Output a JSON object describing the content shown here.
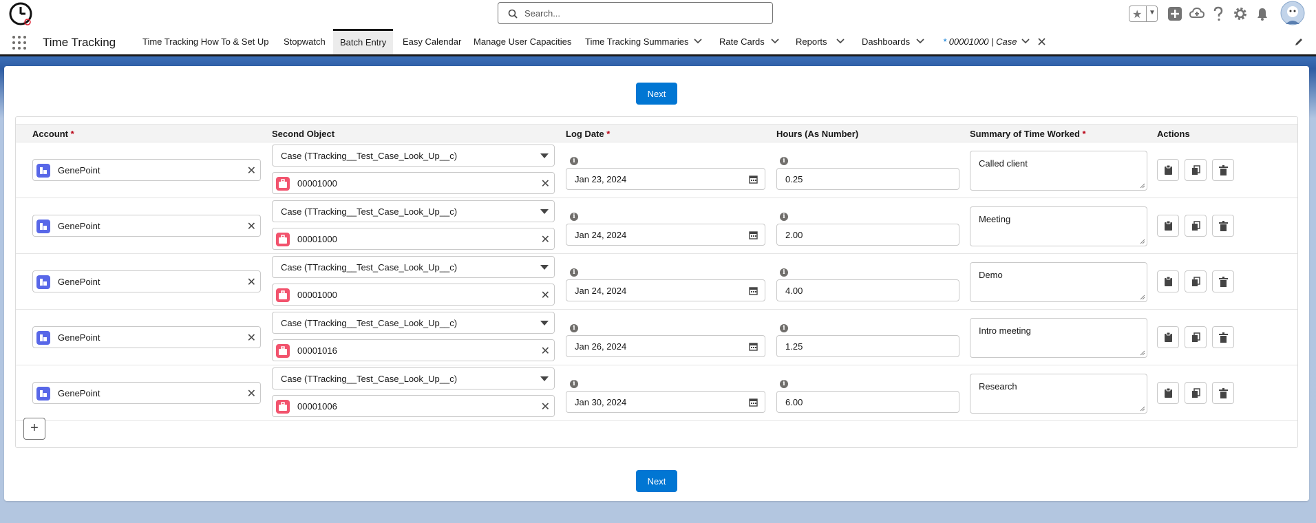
{
  "header": {
    "search_placeholder": "Search..."
  },
  "nav": {
    "app_name": "Time Tracking",
    "items": [
      {
        "label": "Time Tracking How To & Set Up"
      },
      {
        "label": "Stopwatch"
      },
      {
        "label": "Batch Entry"
      },
      {
        "label": "Easy Calendar"
      },
      {
        "label": "Manage User Capacities"
      },
      {
        "label": "Time Tracking Summaries"
      },
      {
        "label": "Rate Cards"
      },
      {
        "label": "Reports"
      },
      {
        "label": "Dashboards"
      }
    ],
    "record_tab": {
      "marker": "*",
      "label": "00001000 | Case"
    }
  },
  "buttons": {
    "next_top": "Next",
    "next_bottom": "Next",
    "add_row": "+"
  },
  "table": {
    "headers": {
      "account": "Account",
      "second_object": "Second Object",
      "log_date": "Log Date",
      "hours": "Hours (As Number)",
      "summary": "Summary of Time Worked",
      "actions": "Actions"
    },
    "required_mark": "*",
    "info_glyph": "i",
    "clear_glyph": "✕",
    "rows": [
      {
        "account": "GenePoint",
        "object_type": "Case (TTracking__Test_Case_Look_Up__c)",
        "record": "00001000",
        "date": "Jan 23, 2024",
        "hours": "0.25",
        "summary": "Called client"
      },
      {
        "account": "GenePoint",
        "object_type": "Case (TTracking__Test_Case_Look_Up__c)",
        "record": "00001000",
        "date": "Jan 24, 2024",
        "hours": "2.00",
        "summary": "Meeting"
      },
      {
        "account": "GenePoint",
        "object_type": "Case (TTracking__Test_Case_Look_Up__c)",
        "record": "00001000",
        "date": "Jan 24, 2024",
        "hours": "4.00",
        "summary": "Demo"
      },
      {
        "account": "GenePoint",
        "object_type": "Case (TTracking__Test_Case_Look_Up__c)",
        "record": "00001016",
        "date": "Jan 26, 2024",
        "hours": "1.25",
        "summary": "Intro meeting"
      },
      {
        "account": "GenePoint",
        "object_type": "Case (TTracking__Test_Case_Look_Up__c)",
        "record": "00001006",
        "date": "Jan 30, 2024",
        "hours": "6.00",
        "summary": "Research"
      }
    ]
  },
  "colors": {
    "brand": "#0176d3",
    "account_icon": "#5867e8",
    "case_icon": "#f2536d",
    "required": "#ba0517"
  },
  "icons": {
    "logo": "stopwatch-logo-icon",
    "search": "search-icon",
    "favorites": "star-icon",
    "global_actions": "add-icon",
    "trailhead": "cloud-help-icon",
    "help": "question-icon",
    "setup": "gear-icon",
    "notifications": "bell-icon",
    "avatar": "user-avatar-icon"
  }
}
